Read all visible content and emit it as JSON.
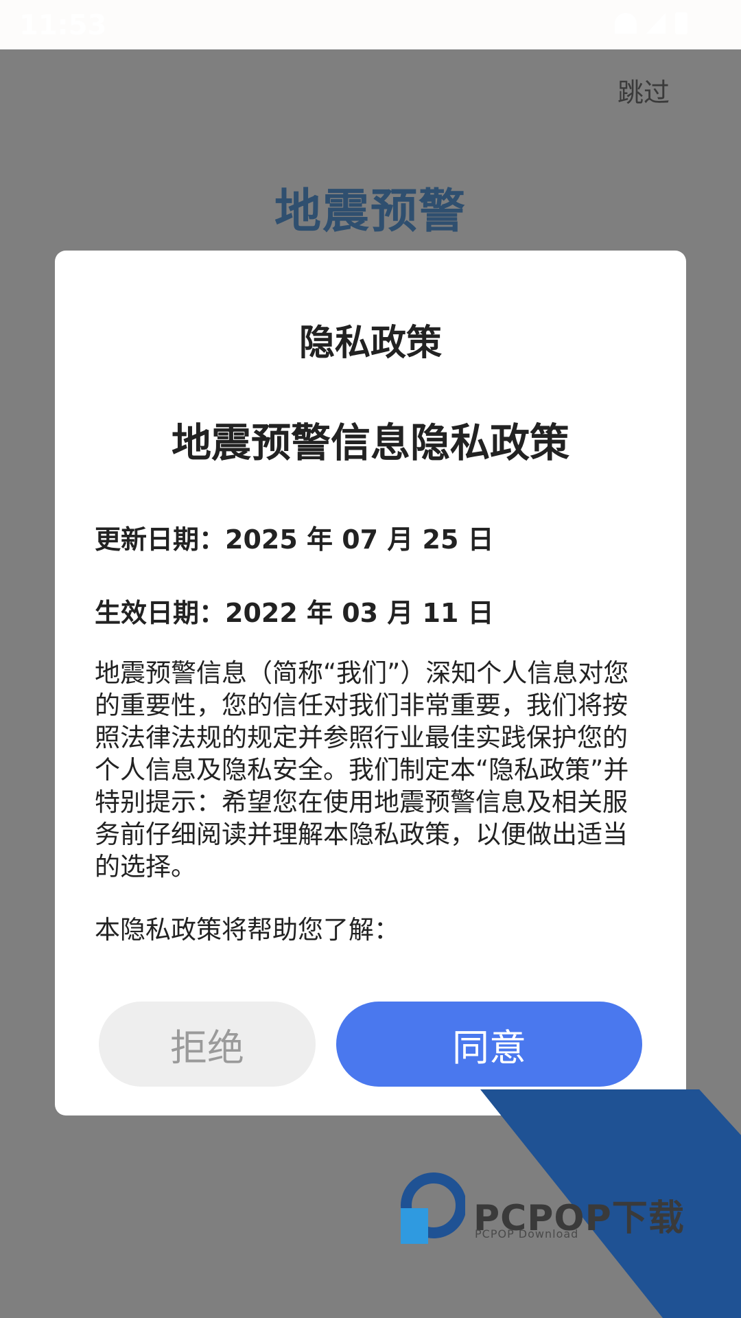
{
  "status_bar": {
    "time": "11:53",
    "icons": [
      "wifi-icon",
      "signal-icon",
      "battery-icon"
    ]
  },
  "header": {
    "skip_label": "跳过",
    "app_title": "地震预警"
  },
  "dialog": {
    "title": "隐私政策",
    "doc_title": "地震预警信息隐私政策",
    "update_date": "更新日期：2025 年 07 月 25 日",
    "effective_date": "生效日期：2022 年 03 月 11 日",
    "body": "地震预警信息（简称“我们”）深知个人信息对您的重要性，您的信任对我们非常重要，我们将按照法律法规的规定并参照行业最佳实践保护您的个人信息及隐私安全。我们制定本“隐私政策”并特别提示：希望您在使用地震预警信息及相关服务前仔细阅读并理解本隐私政策，以便做出适当的选择。",
    "help_intro": "本隐私政策将帮助您了解：",
    "reject_label": "拒绝",
    "agree_label": "同意"
  },
  "watermark": {
    "text": "PCPOP下载",
    "subtext": "PCPOP Download"
  },
  "colors": {
    "overlay": "#7f7f7f",
    "accent": "#4a78ee",
    "app_title": "#2f4f6f",
    "reject_bg": "#eeeeee",
    "watermark_blue": "#1f5294"
  }
}
